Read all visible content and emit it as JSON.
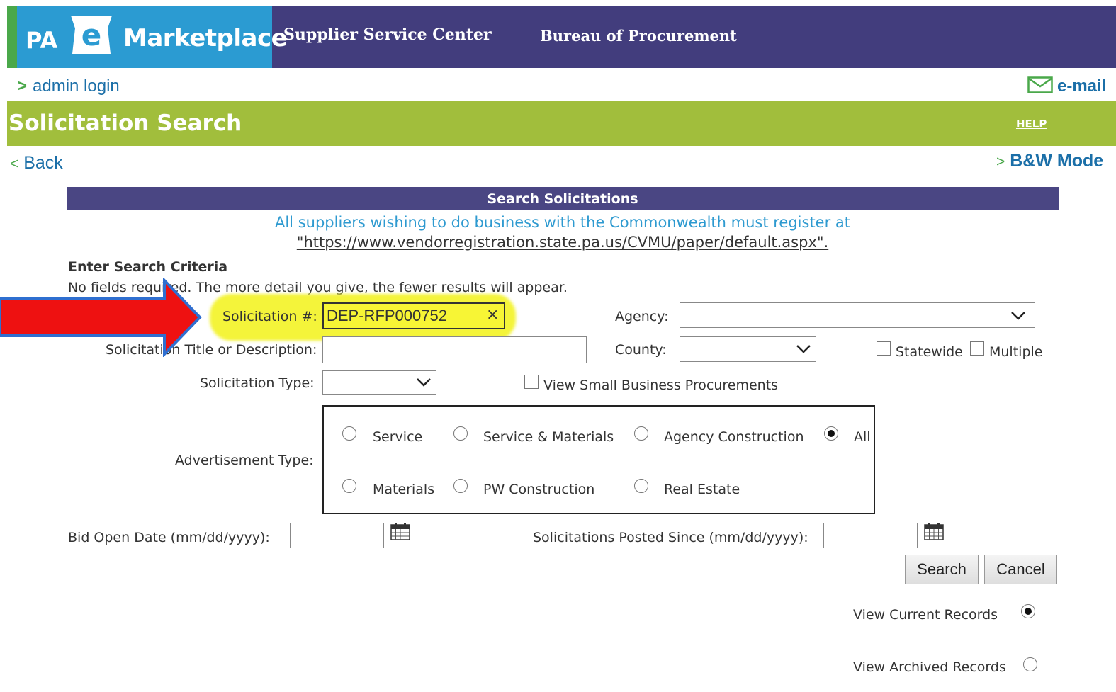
{
  "header": {
    "logo_pa": "PA",
    "logo_e": "e",
    "logo_marketplace": "Marketplace",
    "supplier_service_center": "Supplier Service Center",
    "bureau_of_procurement": "Bureau of Procurement"
  },
  "subnav": {
    "admin_login": "admin login",
    "email": "e-mail"
  },
  "title_bar": {
    "title": "Solicitation Search",
    "help": "HELP"
  },
  "nav": {
    "back": "Back",
    "bw_mode": "B&W Mode"
  },
  "panel": {
    "header": "Search Solicitations",
    "notice_line1": "All suppliers wishing to do business with the Commonwealth must register at",
    "notice_url": "\"https://www.vendorregistration.state.pa.us/CVMU/paper/default.aspx\".",
    "criteria_head": "Enter Search Criteria",
    "criteria_sub": "No fields required. The more detail you give, the fewer results will appear."
  },
  "form": {
    "solicitation_number_label": "Solicitation #:",
    "solicitation_number_value": "DEP-RFP000752",
    "clear_symbol": "×",
    "agency_label": "Agency:",
    "agency_value": "",
    "title_desc_label": "Solicitation Title or Description:",
    "title_desc_value": "",
    "county_label": "County:",
    "county_value": "",
    "statewide_label": "Statewide",
    "multiple_label": "Multiple",
    "solicitation_type_label": "Solicitation Type:",
    "solicitation_type_value": "",
    "small_business_label": "View Small Business Procurements",
    "advertisement_type_label": "Advertisement Type:",
    "advertisement_options": [
      {
        "label": "Service",
        "selected": false
      },
      {
        "label": "Service & Materials",
        "selected": false
      },
      {
        "label": "Agency Construction",
        "selected": false
      },
      {
        "label": "All",
        "selected": true
      },
      {
        "label": "Materials",
        "selected": false
      },
      {
        "label": "PW Construction",
        "selected": false
      },
      {
        "label": "Real Estate",
        "selected": false
      }
    ],
    "bid_open_date_label": "Bid Open Date (mm/dd/yyyy):",
    "bid_open_date_value": "",
    "posted_since_label": "Solicitations Posted Since (mm/dd/yyyy):",
    "posted_since_value": "",
    "search_button": "Search",
    "cancel_button": "Cancel",
    "view_current_label": "View Current Records",
    "view_current_selected": true,
    "view_archived_label": "View Archived Records",
    "view_archived_selected": false
  },
  "colors": {
    "header_bg": "#423d7d",
    "logo_bg": "#2b9bd2",
    "title_bar_bg": "#a1be3c",
    "highlight": "#f4f43a",
    "arrow_red": "#ee1111",
    "arrow_outline": "#2f6fd0"
  },
  "icons": {
    "email": "envelope-icon",
    "calendar": "calendar-icon",
    "dropdown": "chevron-down-icon"
  }
}
